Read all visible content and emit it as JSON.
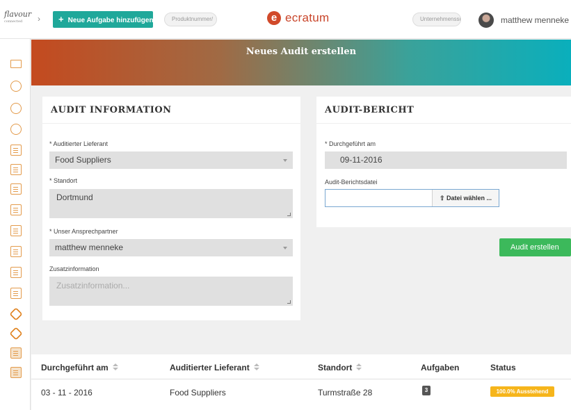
{
  "header": {
    "brand_name": "flavour",
    "brand_sub": "connected",
    "add_task_label": "Neue Aufgabe hinzufügen",
    "product_search_placeholder": "Produktnummer/",
    "logo_text": "ecratum",
    "company_search_placeholder": "Unternehmenssu",
    "user_name": "matthew menneke"
  },
  "banner": {
    "title": "Neues Audit erstellen"
  },
  "audit_information": {
    "title": "AUDIT INFORMATION",
    "supplier_label": "Auditierter Lieferant",
    "supplier_value": "Food Suppliers",
    "location_label": "Standort",
    "location_value": "Dortmund",
    "contact_label": "Unser Ansprechpartner",
    "contact_value": "matthew menneke",
    "extra_label": "Zusatzinformation",
    "extra_placeholder": "Zusatzinformation..."
  },
  "audit_report": {
    "title": "AUDIT-BERICHT",
    "date_label": "Durchgeführt am",
    "date_value": "09-11-2016",
    "file_label": "Audit-Berichtsdatei",
    "file_button": "Datei wählen ...",
    "create_button": "Audit erstellen"
  },
  "table": {
    "headers": [
      "Durchgeführt am",
      "Auditierter Lieferant",
      "Standort",
      "Aufgaben",
      "Status"
    ],
    "rows": [
      {
        "date": "03 - 11 - 2016",
        "supplier": "Food Suppliers",
        "location": "Turmstraße 28",
        "tasks": "3",
        "status": "100.0% Ausstehend"
      }
    ]
  },
  "colors": {
    "accent_teal": "#1fa89a",
    "create_green": "#3cb95b",
    "status_yellow": "#f6b51b",
    "brand_red": "#c9452a"
  }
}
